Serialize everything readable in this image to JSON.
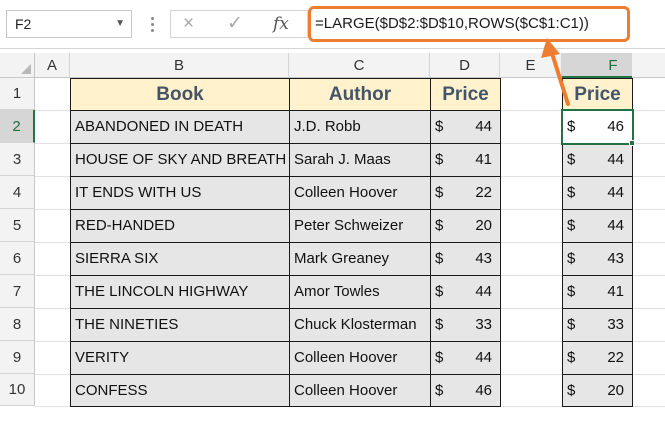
{
  "name_box": "F2",
  "formula": "=LARGE($D$2:$D$10,ROWS($C$1:C1))",
  "icons": {
    "cancel": "×",
    "enter": "✓",
    "function": "fx"
  },
  "columns": [
    "A",
    "B",
    "C",
    "D",
    "E",
    "F"
  ],
  "rows": [
    "1",
    "2",
    "3",
    "4",
    "5",
    "6",
    "7",
    "8",
    "9",
    "10"
  ],
  "table": {
    "headers": {
      "book": "Book",
      "author": "Author",
      "price": "Price"
    },
    "currency": "$",
    "records": [
      {
        "book": "ABANDONED IN DEATH",
        "author": "J.D. Robb",
        "price": "44"
      },
      {
        "book": "HOUSE OF SKY AND BREATH",
        "author": "Sarah J. Maas",
        "price": "41"
      },
      {
        "book": "IT ENDS WITH US",
        "author": "Colleen Hoover",
        "price": "22"
      },
      {
        "book": "RED-HANDED",
        "author": "Peter Schweizer",
        "price": "20"
      },
      {
        "book": "SIERRA SIX",
        "author": "Mark Greaney",
        "price": "43"
      },
      {
        "book": "THE LINCOLN HIGHWAY",
        "author": "Amor Towles",
        "price": "44"
      },
      {
        "book": "THE NINETIES",
        "author": "Chuck Klosterman",
        "price": "33"
      },
      {
        "book": "VERITY",
        "author": "Colleen Hoover",
        "price": "44"
      },
      {
        "book": "CONFESS",
        "author": "Colleen Hoover",
        "price": "46"
      }
    ]
  },
  "result": {
    "header": "Price",
    "values": [
      "46",
      "44",
      "44",
      "44",
      "43",
      "41",
      "33",
      "22",
      "20"
    ]
  },
  "colors": {
    "accent": "#ed7d31",
    "header_fill": "#fff2cc",
    "header_text": "#44546a",
    "selection": "#217346"
  }
}
